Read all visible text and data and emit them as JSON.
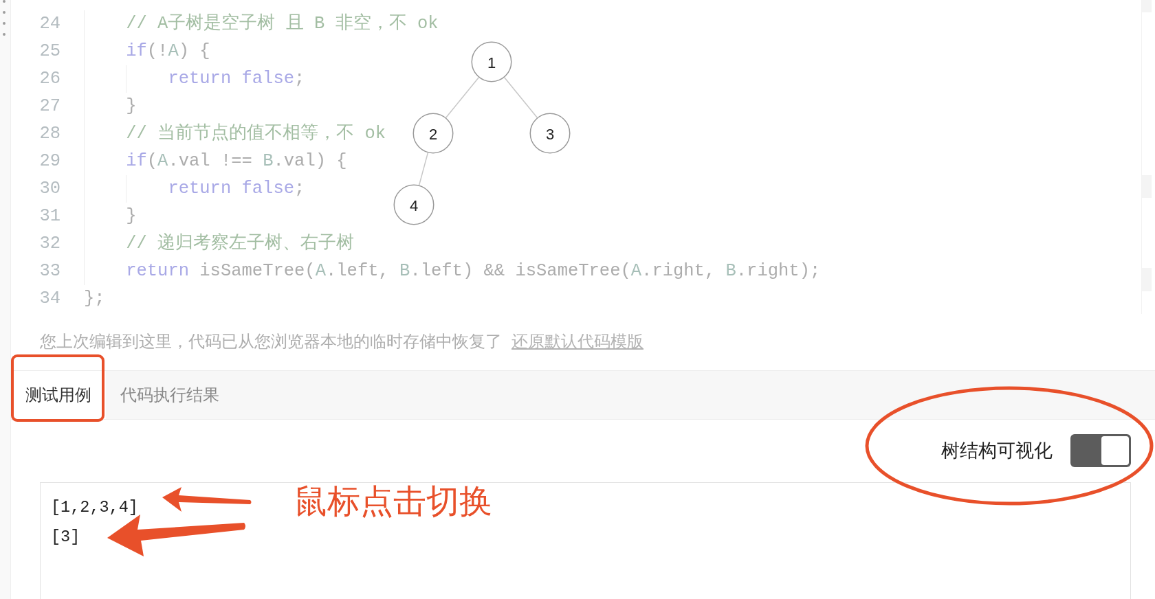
{
  "editor": {
    "lines": [
      {
        "children": [
          {
            "number": "24",
            "tokens": [
              {
                "kind": "comment",
                "text": "// A子树是空子树 且 B 非空，不 ok"
              }
            ]
          },
          {
            "number": "25",
            "tokens": [
              {
                "kind": "keyword",
                "text": "if"
              },
              {
                "kind": "plain",
                "text": "(!"
              },
              {
                "kind": "param",
                "text": "A"
              },
              {
                "kind": "plain",
                "text": ") {"
              }
            ],
            "children": [
              {
                "number": "26",
                "tokens": [
                  {
                    "kind": "keyword",
                    "text": "return"
                  },
                  {
                    "kind": "keyword",
                    "text": " false"
                  },
                  {
                    "kind": "plain",
                    "text": ";"
                  }
                ]
              }
            ]
          },
          {
            "number": "27",
            "tokens": [
              {
                "kind": "plain",
                "text": "}"
              }
            ]
          },
          {
            "number": "28",
            "tokens": [
              {
                "kind": "comment",
                "text": "// 当前节点的值不相等，不 ok"
              }
            ]
          },
          {
            "number": "29",
            "tokens": [
              {
                "kind": "keyword",
                "text": "if"
              },
              {
                "kind": "plain",
                "text": "("
              },
              {
                "kind": "param",
                "text": "A"
              },
              {
                "kind": "plain",
                "text": ".val !== "
              },
              {
                "kind": "param",
                "text": "B"
              },
              {
                "kind": "plain",
                "text": ".val) {"
              }
            ],
            "children": [
              {
                "number": "30",
                "tokens": [
                  {
                    "kind": "keyword",
                    "text": "return"
                  },
                  {
                    "kind": "keyword",
                    "text": " false"
                  },
                  {
                    "kind": "plain",
                    "text": ";"
                  }
                ]
              }
            ]
          },
          {
            "number": "31",
            "tokens": [
              {
                "kind": "plain",
                "text": "}"
              }
            ]
          },
          {
            "number": "32",
            "tokens": [
              {
                "kind": "comment",
                "text": "// 递归考察左子树、右子树"
              }
            ]
          },
          {
            "number": "33",
            "tokens": [
              {
                "kind": "keyword",
                "text": "return"
              },
              {
                "kind": "plain",
                "text": " isSameTree("
              },
              {
                "kind": "param",
                "text": "A"
              },
              {
                "kind": "plain",
                "text": ".left, "
              },
              {
                "kind": "param",
                "text": "B"
              },
              {
                "kind": "plain",
                "text": ".left) && isSameTree("
              },
              {
                "kind": "param",
                "text": "A"
              },
              {
                "kind": "plain",
                "text": ".right, "
              },
              {
                "kind": "param",
                "text": "B"
              },
              {
                "kind": "plain",
                "text": ".right);"
              }
            ]
          }
        ]
      },
      {
        "number": "34",
        "tokens": [
          {
            "kind": "plain",
            "text": "};"
          }
        ]
      }
    ]
  },
  "tree_view": {
    "root": {
      "value": "1",
      "children": [
        {
          "value": "2",
          "kind": "left",
          "children": [
            {
              "value": "4",
              "kind": "left"
            }
          ]
        },
        {
          "value": "3",
          "kind": "right"
        }
      ]
    }
  },
  "restore_notice": {
    "text": "您上次编辑到这里，代码已从您浏览器本地的临时存储中恢复了",
    "link": "还原默认代码模版"
  },
  "tabs": [
    {
      "label": "测试用例",
      "selected": true
    },
    {
      "label": "代码执行结果",
      "selected": false
    }
  ],
  "visualization_toggle": {
    "label": "树结构可视化",
    "on": true
  },
  "test_case": {
    "lines": [
      "[1,2,3,4]",
      "[3]"
    ]
  },
  "annotation": {
    "text": "鼠标点击切换"
  }
}
